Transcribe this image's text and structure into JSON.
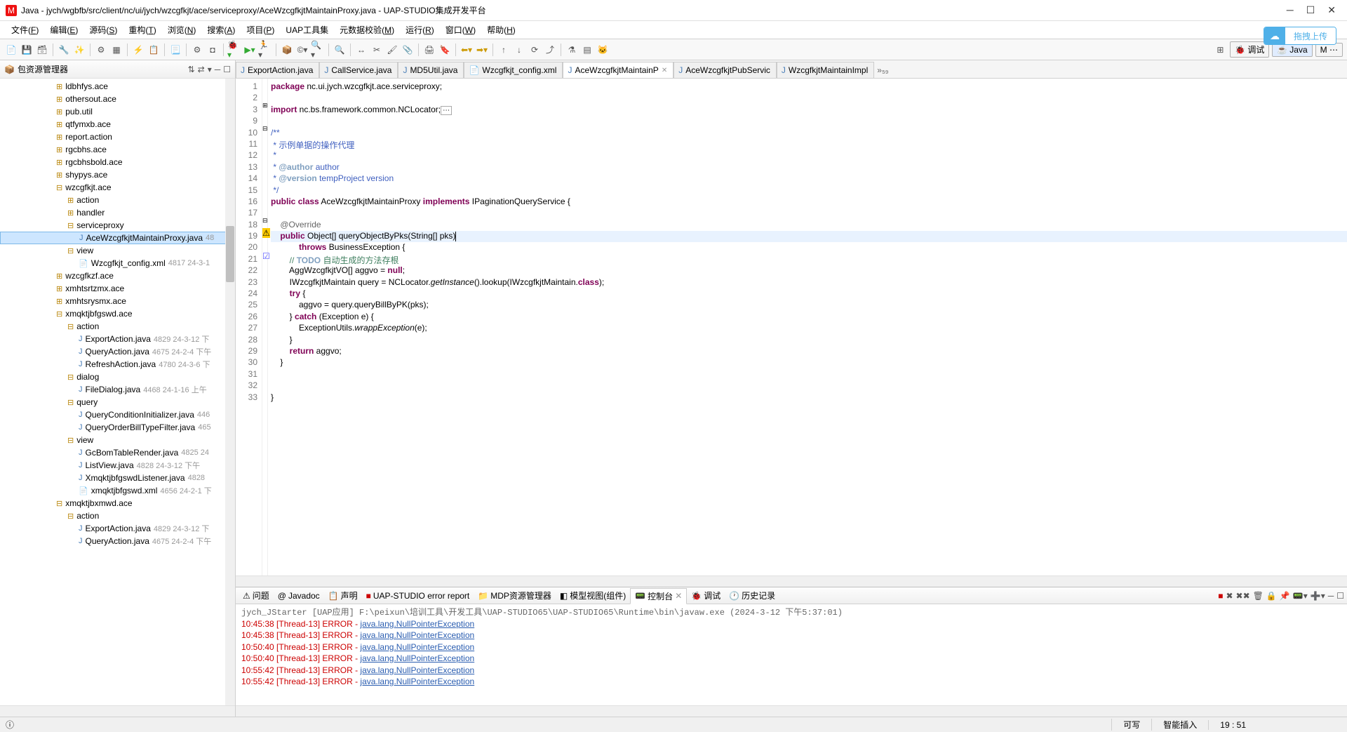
{
  "window": {
    "title": "Java - jych/wgbfb/src/client/nc/ui/jych/wzcgfkjt/ace/serviceproxy/AceWzcgfkjtMaintainProxy.java - UAP-STUDIO集成开发平台"
  },
  "menu": {
    "items": [
      "文件(F)",
      "编辑(E)",
      "源码(S)",
      "重构(T)",
      "浏览(N)",
      "搜索(A)",
      "项目(P)",
      "UAP工具集",
      "元数据校验(M)",
      "运行(R)",
      "窗口(W)",
      "帮助(H)"
    ]
  },
  "upload": {
    "label": "拖拽上传"
  },
  "perspective": {
    "debug": "调试",
    "java": "Java"
  },
  "sidebar": {
    "title": "包资源管理器",
    "items": [
      {
        "type": "pkg",
        "indent": 5,
        "label": "ldbhfys.ace"
      },
      {
        "type": "pkg",
        "indent": 5,
        "label": "othersout.ace"
      },
      {
        "type": "pkg",
        "indent": 5,
        "label": "pub.util"
      },
      {
        "type": "pkg",
        "indent": 5,
        "label": "qtfymxb.ace"
      },
      {
        "type": "pkg",
        "indent": 5,
        "label": "report.action"
      },
      {
        "type": "pkg",
        "indent": 5,
        "label": "rgcbhs.ace"
      },
      {
        "type": "pkg",
        "indent": 5,
        "label": "rgcbhsbold.ace"
      },
      {
        "type": "pkg",
        "indent": 5,
        "label": "shypys.ace"
      },
      {
        "type": "pkg-open",
        "indent": 5,
        "label": "wzcgfkjt.ace"
      },
      {
        "type": "pkg",
        "indent": 6,
        "label": "action"
      },
      {
        "type": "pkg",
        "indent": 6,
        "label": "handler"
      },
      {
        "type": "pkg-open",
        "indent": 6,
        "label": "serviceproxy"
      },
      {
        "type": "java",
        "indent": 7,
        "label": "AceWzcgfkjtMaintainProxy.java",
        "meta": "48",
        "selected": true
      },
      {
        "type": "pkg-open",
        "indent": 6,
        "label": "view"
      },
      {
        "type": "xml",
        "indent": 7,
        "label": "Wzcgfkjt_config.xml",
        "meta": "4817  24-3-1"
      },
      {
        "type": "pkg",
        "indent": 5,
        "label": "wzcgfkzf.ace"
      },
      {
        "type": "pkg",
        "indent": 5,
        "label": "xmhtsrtzmx.ace"
      },
      {
        "type": "pkg",
        "indent": 5,
        "label": "xmhtsrysmx.ace"
      },
      {
        "type": "pkg-open",
        "indent": 5,
        "label": "xmqktjbfgswd.ace"
      },
      {
        "type": "pkg-open",
        "indent": 6,
        "label": "action"
      },
      {
        "type": "java",
        "indent": 7,
        "label": "ExportAction.java",
        "meta": "4829  24-3-12 下"
      },
      {
        "type": "java",
        "indent": 7,
        "label": "QueryAction.java",
        "meta": "4675  24-2-4 下午"
      },
      {
        "type": "java",
        "indent": 7,
        "label": "RefreshAction.java",
        "meta": "4780  24-3-6 下"
      },
      {
        "type": "pkg-open",
        "indent": 6,
        "label": "dialog"
      },
      {
        "type": "java",
        "indent": 7,
        "label": "FileDialog.java",
        "meta": "4468  24-1-16 上午"
      },
      {
        "type": "pkg-open",
        "indent": 6,
        "label": "query"
      },
      {
        "type": "java",
        "indent": 7,
        "label": "QueryConditionInitializer.java",
        "meta": "446"
      },
      {
        "type": "java",
        "indent": 7,
        "label": "QueryOrderBillTypeFilter.java",
        "meta": "465"
      },
      {
        "type": "pkg-open",
        "indent": 6,
        "label": "view"
      },
      {
        "type": "java",
        "indent": 7,
        "label": "GcBomTableRender.java",
        "meta": "4825  24"
      },
      {
        "type": "java",
        "indent": 7,
        "label": "ListView.java",
        "meta": "4828  24-3-12 下午"
      },
      {
        "type": "java",
        "indent": 7,
        "label": "XmqktjbfgswdListener.java",
        "meta": "4828"
      },
      {
        "type": "xml",
        "indent": 7,
        "label": "xmqktjbfgswd.xml",
        "meta": "4656  24-2-1 下"
      },
      {
        "type": "pkg-open",
        "indent": 5,
        "label": "xmqktjbxmwd.ace"
      },
      {
        "type": "pkg-open",
        "indent": 6,
        "label": "action"
      },
      {
        "type": "java",
        "indent": 7,
        "label": "ExportAction.java",
        "meta": "4829  24-3-12 下"
      },
      {
        "type": "java",
        "indent": 7,
        "label": "QueryAction.java",
        "meta": "4675  24-2-4 下午"
      }
    ]
  },
  "editorTabs": [
    {
      "label": "ExportAction.java",
      "icon": "java"
    },
    {
      "label": "CallService.java",
      "icon": "java"
    },
    {
      "label": "MD5Util.java",
      "icon": "java"
    },
    {
      "label": "Wzcgfkjt_config.xml",
      "icon": "xml"
    },
    {
      "label": "AceWzcgfkjtMaintainP",
      "icon": "java",
      "active": true,
      "close": true
    },
    {
      "label": "AceWzcgfkjtPubServic",
      "icon": "java"
    },
    {
      "label": "WzcgfkjtMaintainImpl",
      "icon": "java"
    }
  ],
  "editorMore": "»₅₉",
  "code": {
    "lines": [
      {
        "n": "1",
        "html": "<span class='kw'>package</span> nc.ui.jych.wzcgfkjt.ace.serviceproxy;"
      },
      {
        "n": "2",
        "html": ""
      },
      {
        "n": "3",
        "html": "<span class='kw'>import</span> nc.bs.framework.common.NCLocator;<span style='border:1px solid #aaa;padding:0 2px;font-size:10px;'>⋯</span>",
        "fold": "+"
      },
      {
        "n": "9",
        "html": ""
      },
      {
        "n": "10",
        "html": "<span class='cm2'>/**</span>",
        "fold": "-"
      },
      {
        "n": "11",
        "html": "<span class='cm2'> * </span><span class='cm2'>示例单据的操作代理</span>"
      },
      {
        "n": "12",
        "html": "<span class='cm2'> * </span>"
      },
      {
        "n": "13",
        "html": "<span class='cm2'> * </span><span class='tag-doc'>@author</span><span class='cm2'> author</span>"
      },
      {
        "n": "14",
        "html": "<span class='cm2'> * </span><span class='tag-doc'>@version</span><span class='cm2'> tempProject version</span>"
      },
      {
        "n": "15",
        "html": "<span class='cm2'> */</span>"
      },
      {
        "n": "16",
        "html": "<span class='kw'>public</span> <span class='kw'>class</span> AceWzcgfkjtMaintainProxy <span class='kw'>implements</span> IPaginationQueryService {"
      },
      {
        "n": "17",
        "html": ""
      },
      {
        "n": "18",
        "html": "    <span class='ann'>@Override</span>",
        "fold": "-"
      },
      {
        "n": "19",
        "html": "    <span class='kw'>public</span> Object[] queryObjectByPks(String[] pks)<span class='cursor-caret'></span>",
        "hl": true,
        "warn": true
      },
      {
        "n": "20",
        "html": "            <span class='kw'>throws</span> BusinessException {"
      },
      {
        "n": "21",
        "html": "        <span class='cm'>// </span><span class='todo'>TODO</span><span class='cm'> 自动生成的方法存根</span>",
        "task": true
      },
      {
        "n": "22",
        "html": "        AggWzcgfkjtVO[] aggvo = <span class='kw'>null</span>;"
      },
      {
        "n": "23",
        "html": "        IWzcgfkjtMaintain query = NCLocator.<span class='it'>getInstance</span>().lookup(IWzcgfkjtMaintain.<span class='kw'>class</span>);"
      },
      {
        "n": "24",
        "html": "        <span class='kw'>try</span> {"
      },
      {
        "n": "25",
        "html": "            aggvo = query.queryBillByPK(pks);"
      },
      {
        "n": "26",
        "html": "        } <span class='kw'>catch</span> (Exception e) {"
      },
      {
        "n": "27",
        "html": "            ExceptionUtils.<span class='it'>wrappException</span>(e);"
      },
      {
        "n": "28",
        "html": "        }"
      },
      {
        "n": "29",
        "html": "        <span class='kw'>return</span> aggvo;"
      },
      {
        "n": "30",
        "html": "    }"
      },
      {
        "n": "31",
        "html": ""
      },
      {
        "n": "32",
        "html": ""
      },
      {
        "n": "33",
        "html": "}"
      }
    ]
  },
  "consoleTabs": [
    {
      "label": "问题",
      "icon": "⚠"
    },
    {
      "label": "Javadoc",
      "icon": "@"
    },
    {
      "label": "声明",
      "icon": "📋"
    },
    {
      "label": "UAP-STUDIO error report",
      "icon": "■",
      "red": true
    },
    {
      "label": "MDP资源管理器",
      "icon": "📁"
    },
    {
      "label": "模型视图(组件)",
      "icon": "◧"
    },
    {
      "label": "控制台",
      "icon": "📟",
      "active": true,
      "close": true
    },
    {
      "label": "调试",
      "icon": "🐞"
    },
    {
      "label": "历史记录",
      "icon": "🕐"
    }
  ],
  "consoleInfo": "jych_JStarter [UAP应用] F:\\peixun\\培训工具\\开发工具\\UAP-STUDIO65\\UAP-STUDIO65\\Runtime\\bin\\javaw.exe (2024-3-12 下午5:37:01)",
  "consoleLines": [
    {
      "pre": "10:45:38 [Thread-13] ERROR - ",
      "link": "java.lang.NullPointerException"
    },
    {
      "pre": "10:45:38 [Thread-13] ERROR - ",
      "link": "java.lang.NullPointerException"
    },
    {
      "pre": "10:50:40 [Thread-13] ERROR - ",
      "link": "java.lang.NullPointerException"
    },
    {
      "pre": "10:50:40 [Thread-13] ERROR - ",
      "link": "java.lang.NullPointerException"
    },
    {
      "pre": "10:55:42 [Thread-13] ERROR - ",
      "link": "java.lang.NullPointerException"
    },
    {
      "pre": "10:55:42 [Thread-13] ERROR - ",
      "link": "java.lang.NullPointerException"
    }
  ],
  "status": {
    "writable": "可写",
    "insert": "智能插入",
    "pos": "19 :  51"
  }
}
